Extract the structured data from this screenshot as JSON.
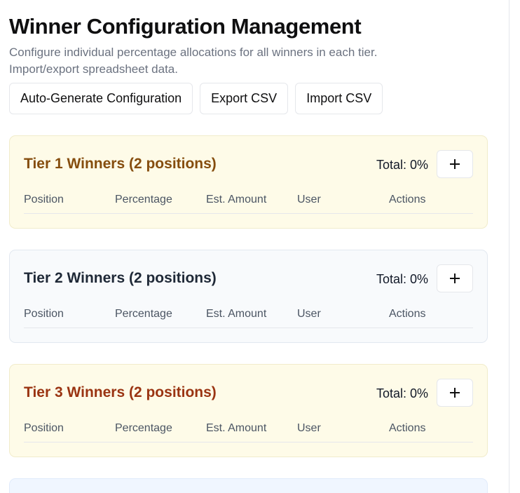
{
  "header": {
    "title": "Winner Configuration Management",
    "description": "Configure individual percentage allocations for all winners in each tier. Import/export spreadsheet data."
  },
  "actions": {
    "auto_generate": "Auto-Generate Configuration",
    "export_csv": "Export CSV",
    "import_csv": "Import CSV"
  },
  "columns": {
    "position": "Position",
    "percentage": "Percentage",
    "est_amount": "Est. Amount",
    "user": "User",
    "actions": "Actions"
  },
  "tiers": [
    {
      "title": "Tier 1 Winners (2 positions)",
      "total": "Total: 0%",
      "color": "#854d0e",
      "background": "#fefbe8"
    },
    {
      "title": "Tier 2 Winners (2 positions)",
      "total": "Total: 0%",
      "color": "#1f2937",
      "background": "#f8fafc"
    },
    {
      "title": "Tier 3 Winners (2 positions)",
      "total": "Total: 0%",
      "color": "#9a3412",
      "background": "#fefbe8"
    }
  ],
  "icons": {
    "add": "plus-icon"
  }
}
